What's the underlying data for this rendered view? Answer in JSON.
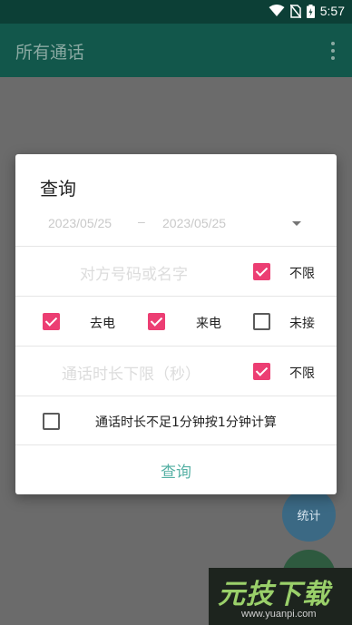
{
  "status_bar": {
    "time": "5:57",
    "icons": [
      "wifi-icon",
      "no-sim-icon",
      "battery-charging-icon"
    ]
  },
  "app_bar": {
    "title": "所有通话",
    "menu_icon": "more-vert-icon"
  },
  "fabs": {
    "stats_label": "统计"
  },
  "watermark": {
    "brand": "元技下载",
    "url": "www.yuanpi.com"
  },
  "dialog": {
    "title": "查询",
    "date_from": "2023/05/25",
    "date_separator": "–",
    "date_to": "2023/05/25",
    "name_placeholder": "对方号码或名字",
    "name_unlimited": {
      "label": "不限",
      "checked": true
    },
    "call_types": [
      {
        "label": "去电",
        "checked": true
      },
      {
        "label": "来电",
        "checked": true
      },
      {
        "label": "未接",
        "checked": false
      }
    ],
    "duration_placeholder": "通话时长下限（秒）",
    "duration_unlimited": {
      "label": "不限",
      "checked": true
    },
    "round_up": {
      "label": "通话时长不足1分钟按1分钟计算",
      "checked": false
    },
    "query_button": "查询"
  },
  "colors": {
    "accent": "#ec3e73",
    "button_text": "#55b0a4",
    "app_bar": "#12574b",
    "status_bar": "#0c3f36"
  }
}
